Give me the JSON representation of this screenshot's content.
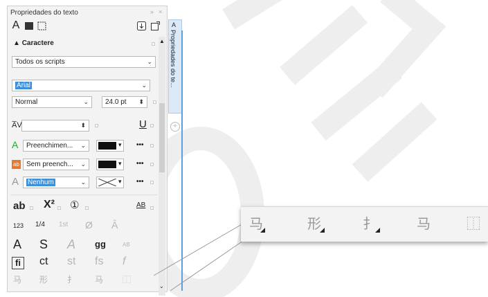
{
  "panel": {
    "title": "Propriedades do texto",
    "title_controls": [
      "»",
      "×"
    ],
    "section": "Caractere",
    "script": "Todos os scripts",
    "font": "Arial",
    "style": "Normal",
    "size": "24.0 pt",
    "fill1": "Preenchimen...",
    "fill2": "Sem preench...",
    "outline": "Nenhum",
    "more": "•••",
    "side_tab": "Propriedades do te..."
  },
  "glyphs": {
    "row1": [
      "ab",
      "X²",
      "①",
      "AB"
    ],
    "row2": [
      "123",
      "1/4",
      "1st",
      "Ø",
      "Ȃ"
    ],
    "row3": [
      "A",
      "S",
      "A",
      "gg",
      "AB"
    ],
    "row4": [
      "fi",
      "ct",
      "st",
      "fs",
      "f"
    ],
    "row5": [
      "⻢",
      "形",
      "⺘",
      "⻢",
      "⿰"
    ]
  },
  "zoom": {
    "glyphs": [
      "⻢",
      "形",
      "⺘",
      "⻢",
      "⿰"
    ]
  },
  "watermark_color": "#ececec",
  "accent": "#3c8fd8"
}
